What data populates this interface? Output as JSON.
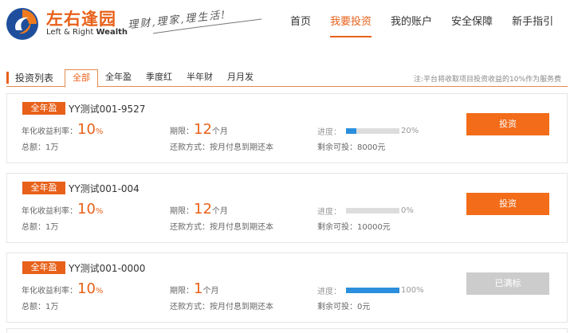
{
  "brand": {
    "name": "左右逢园",
    "sub_left": "Left & Right ",
    "sub_bold": "Wealth",
    "slogan": "理财,理家,理生活!"
  },
  "nav": [
    {
      "label": "首页",
      "active": false
    },
    {
      "label": "我要投资",
      "active": true
    },
    {
      "label": "我的账户",
      "active": false
    },
    {
      "label": "安全保障",
      "active": false
    },
    {
      "label": "新手指引",
      "active": false
    }
  ],
  "list": {
    "title": "投资列表",
    "tabs": [
      "全部",
      "全年盈",
      "季度红",
      "半年财",
      "月月发"
    ],
    "active_tab": 0,
    "note": "注:平台将收取项目投资收益的10%作为服务费"
  },
  "products": [
    {
      "badge": "全年盈",
      "title": "YY测试001-9527",
      "rate_label": "年化收益利率：",
      "rate": "10",
      "rate_unit": "%",
      "term_label": "期限：",
      "term": "12",
      "term_unit": "个月",
      "progress_label": "进度：",
      "progress": 0.2,
      "progress_text": "20%",
      "total": "总额：1万",
      "repay": "还款方式：按月付息到期还本",
      "remain": "剩余可投：8000元",
      "button": "投资",
      "enabled": true
    },
    {
      "badge": "全年盈",
      "title": "YY测试001-004",
      "rate_label": "年化收益利率：",
      "rate": "10",
      "rate_unit": "%",
      "term_label": "期限：",
      "term": "12",
      "term_unit": "个月",
      "progress_label": "进度：",
      "progress": 0.0,
      "progress_text": "0%",
      "total": "总额：1万",
      "repay": "还款方式：按月付息到期还本",
      "remain": "剩余可投：10000元",
      "button": "投资",
      "enabled": true
    },
    {
      "badge": "全年盈",
      "title": "YY测试001-0000",
      "rate_label": "年化收益利率：",
      "rate": "10",
      "rate_unit": "%",
      "term_label": "期限：",
      "term": "1",
      "term_unit": "个月",
      "progress_label": "进度：",
      "progress": 1.0,
      "progress_text": "100%",
      "total": "总额：1万",
      "repay": "还款方式：按月付息到期还本",
      "remain": "剩余可投：0元",
      "button": "已满标",
      "enabled": false
    }
  ],
  "colors": {
    "accent": "#e8611a",
    "progress": "#2b8fdd",
    "disabled": "#cccccc"
  }
}
